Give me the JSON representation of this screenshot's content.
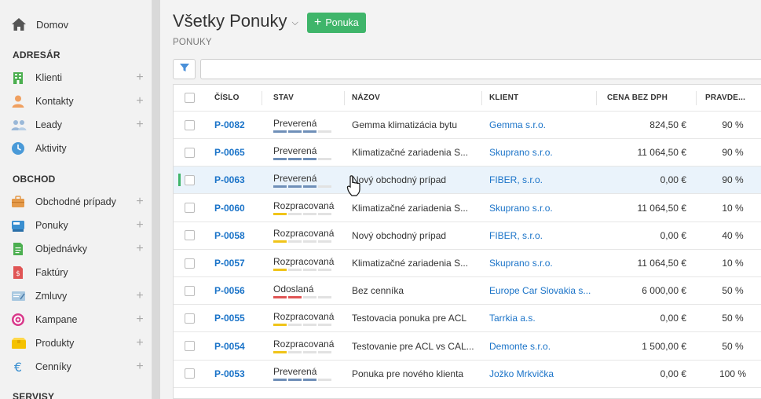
{
  "sidebar": {
    "home": {
      "label": "Domov",
      "icon": "house-icon"
    },
    "sections": [
      {
        "title": "ADRESÁR"
      },
      {
        "title": "OBCHOD"
      },
      {
        "title": "SERVISY"
      }
    ],
    "items": [
      {
        "label": "Klienti",
        "icon": "building-icon",
        "color": "#4caf50",
        "plus": "+"
      },
      {
        "label": "Kontakty",
        "icon": "person-icon",
        "color": "#f0a060",
        "plus": "+"
      },
      {
        "label": "Leady",
        "icon": "people-icon",
        "color": "#9ab8d8",
        "plus": "+"
      },
      {
        "label": "Aktivity",
        "icon": "clock-icon",
        "color": "#4a9ad8",
        "plus": ""
      },
      {
        "label": "Obchodné prípady",
        "icon": "briefcase-icon",
        "color": "#e59a4a",
        "plus": "+"
      },
      {
        "label": "Ponuky",
        "icon": "register-icon",
        "color": "#3a8fd0",
        "plus": "+"
      },
      {
        "label": "Objednávky",
        "icon": "document-icon",
        "color": "#4caf50",
        "plus": "+"
      },
      {
        "label": "Faktúry",
        "icon": "invoice-icon",
        "color": "#e05555",
        "plus": ""
      },
      {
        "label": "Zmluvy",
        "icon": "contract-icon",
        "color": "#a8c8e0",
        "plus": "+"
      },
      {
        "label": "Kampane",
        "icon": "target-icon",
        "color": "#d8388a",
        "plus": "+"
      },
      {
        "label": "Produkty",
        "icon": "box-icon",
        "color": "#f5c200",
        "plus": "+"
      },
      {
        "label": "Cenníky",
        "icon": "euro-icon",
        "color": "#3a8fd0",
        "plus": "+"
      }
    ]
  },
  "header": {
    "title": "Všetky Ponuky",
    "chevron": "⌵",
    "new_button": "Ponuka",
    "breadcrumb": "PONUKY",
    "search_value": ""
  },
  "table": {
    "columns": [
      "ČÍSLO",
      "STAV",
      "NÁZOV",
      "KLIENT",
      "CENA BEZ DPH",
      "PRAVDE..."
    ],
    "colors": {
      "preverena": "#6f8fb8",
      "rozpracovana": "#f0c419",
      "odoslana": "#e05555",
      "empty": "#e2e2e2"
    },
    "rows": [
      {
        "num": "P-0082",
        "status": "Preverená",
        "status_key": "preverena",
        "stage": 3,
        "name": "Gemma klimatizácia bytu",
        "client": "Gemma s.r.o.",
        "price": "824,50 €",
        "prob": "90 %"
      },
      {
        "num": "P-0065",
        "status": "Preverená",
        "status_key": "preverena",
        "stage": 3,
        "name": "Klimatizačné zariadenia S...",
        "client": "Skuprano s.r.o.",
        "price": "11 064,50 €",
        "prob": "90 %"
      },
      {
        "num": "P-0063",
        "status": "Preverená",
        "status_key": "preverena",
        "stage": 3,
        "name": "Nový obchodný prípad",
        "client": "FIBER, s.r.o.",
        "price": "0,00 €",
        "prob": "90 %"
      },
      {
        "num": "P-0060",
        "status": "Rozpracovaná",
        "status_key": "rozpracovana",
        "stage": 1,
        "name": "Klimatizačné zariadenia S...",
        "client": "Skuprano s.r.o.",
        "price": "11 064,50 €",
        "prob": "10 %"
      },
      {
        "num": "P-0058",
        "status": "Rozpracovaná",
        "status_key": "rozpracovana",
        "stage": 1,
        "name": "Nový obchodný prípad",
        "client": "FIBER, s.r.o.",
        "price": "0,00 €",
        "prob": "40 %"
      },
      {
        "num": "P-0057",
        "status": "Rozpracovaná",
        "status_key": "rozpracovana",
        "stage": 1,
        "name": "Klimatizačné zariadenia S...",
        "client": "Skuprano s.r.o.",
        "price": "11 064,50 €",
        "prob": "10 %"
      },
      {
        "num": "P-0056",
        "status": "Odoslaná",
        "status_key": "odoslana",
        "stage": 2,
        "name": "Bez cenníka",
        "client": "Europe Car Slovakia s...",
        "price": "6 000,00 €",
        "prob": "50 %"
      },
      {
        "num": "P-0055",
        "status": "Rozpracovaná",
        "status_key": "rozpracovana",
        "stage": 1,
        "name": "Testovacia ponuka pre ACL",
        "client": "Tarrkia a.s.",
        "price": "0,00 €",
        "prob": "50 %"
      },
      {
        "num": "P-0054",
        "status": "Rozpracovaná",
        "status_key": "rozpracovana",
        "stage": 1,
        "name": "Testovanie pre ACL vs CAL...",
        "client": "Demonte s.r.o.",
        "price": "1 500,00 €",
        "prob": "50 %"
      },
      {
        "num": "P-0053",
        "status": "Preverená",
        "status_key": "preverena",
        "stage": 3,
        "name": "Ponuka pre nového klienta",
        "client": "Jožko Mrkvička",
        "price": "0,00 €",
        "prob": "100 %"
      }
    ]
  }
}
